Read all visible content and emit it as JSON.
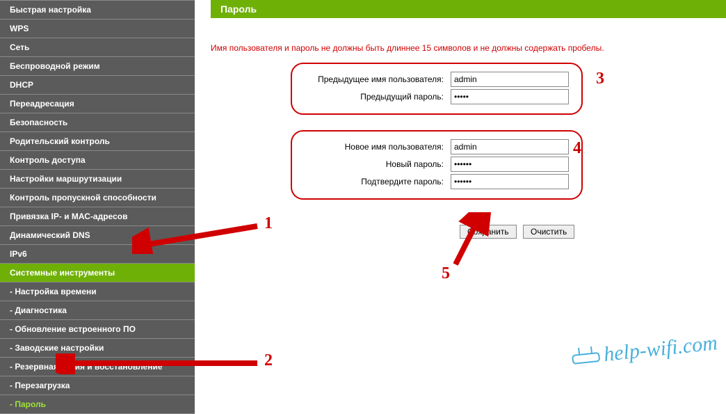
{
  "sidebar": {
    "items": [
      {
        "label": "Быстрая настройка",
        "type": "item"
      },
      {
        "label": "WPS",
        "type": "item"
      },
      {
        "label": "Сеть",
        "type": "item"
      },
      {
        "label": "Беспроводной режим",
        "type": "item"
      },
      {
        "label": "DHCP",
        "type": "item"
      },
      {
        "label": "Переадресация",
        "type": "item"
      },
      {
        "label": "Безопасность",
        "type": "item"
      },
      {
        "label": "Родительский контроль",
        "type": "item"
      },
      {
        "label": "Контроль доступа",
        "type": "item"
      },
      {
        "label": "Настройки маршрутизации",
        "type": "item"
      },
      {
        "label": "Контроль пропускной способности",
        "type": "item"
      },
      {
        "label": "Привязка IP- и МАС-адресов",
        "type": "item"
      },
      {
        "label": "Динамический DNS",
        "type": "item"
      },
      {
        "label": "IPv6",
        "type": "item"
      },
      {
        "label": "Системные инструменты",
        "type": "item",
        "active": true
      },
      {
        "label": "- Настройка времени",
        "type": "sub"
      },
      {
        "label": "- Диагностика",
        "type": "sub"
      },
      {
        "label": "- Обновление встроенного ПО",
        "type": "sub"
      },
      {
        "label": "- Заводские настройки",
        "type": "sub"
      },
      {
        "label": "- Резервная копия и восстановление",
        "type": "sub"
      },
      {
        "label": "- Перезагрузка",
        "type": "sub"
      },
      {
        "label": "- Пароль",
        "type": "sub",
        "active": true
      }
    ]
  },
  "main": {
    "title": "Пароль",
    "warning": "Имя пользователя и пароль не должны быть длиннее 15 символов и не должны содержать пробелы.",
    "group1": {
      "old_user_label": "Предыдущее имя пользователя:",
      "old_user_value": "admin",
      "old_pass_label": "Предыдущий пароль:",
      "old_pass_value": "•••••"
    },
    "group2": {
      "new_user_label": "Новое имя пользователя:",
      "new_user_value": "admin",
      "new_pass_label": "Новый пароль:",
      "new_pass_value": "••••••",
      "confirm_label": "Подтвердите пароль:",
      "confirm_value": "••••••"
    },
    "buttons": {
      "save": "Сохранить",
      "clear": "Очистить"
    }
  },
  "annotations": {
    "n1": "1",
    "n2": "2",
    "n3": "3",
    "n4": "4",
    "n5": "5"
  },
  "watermark": "help-wifi.com"
}
